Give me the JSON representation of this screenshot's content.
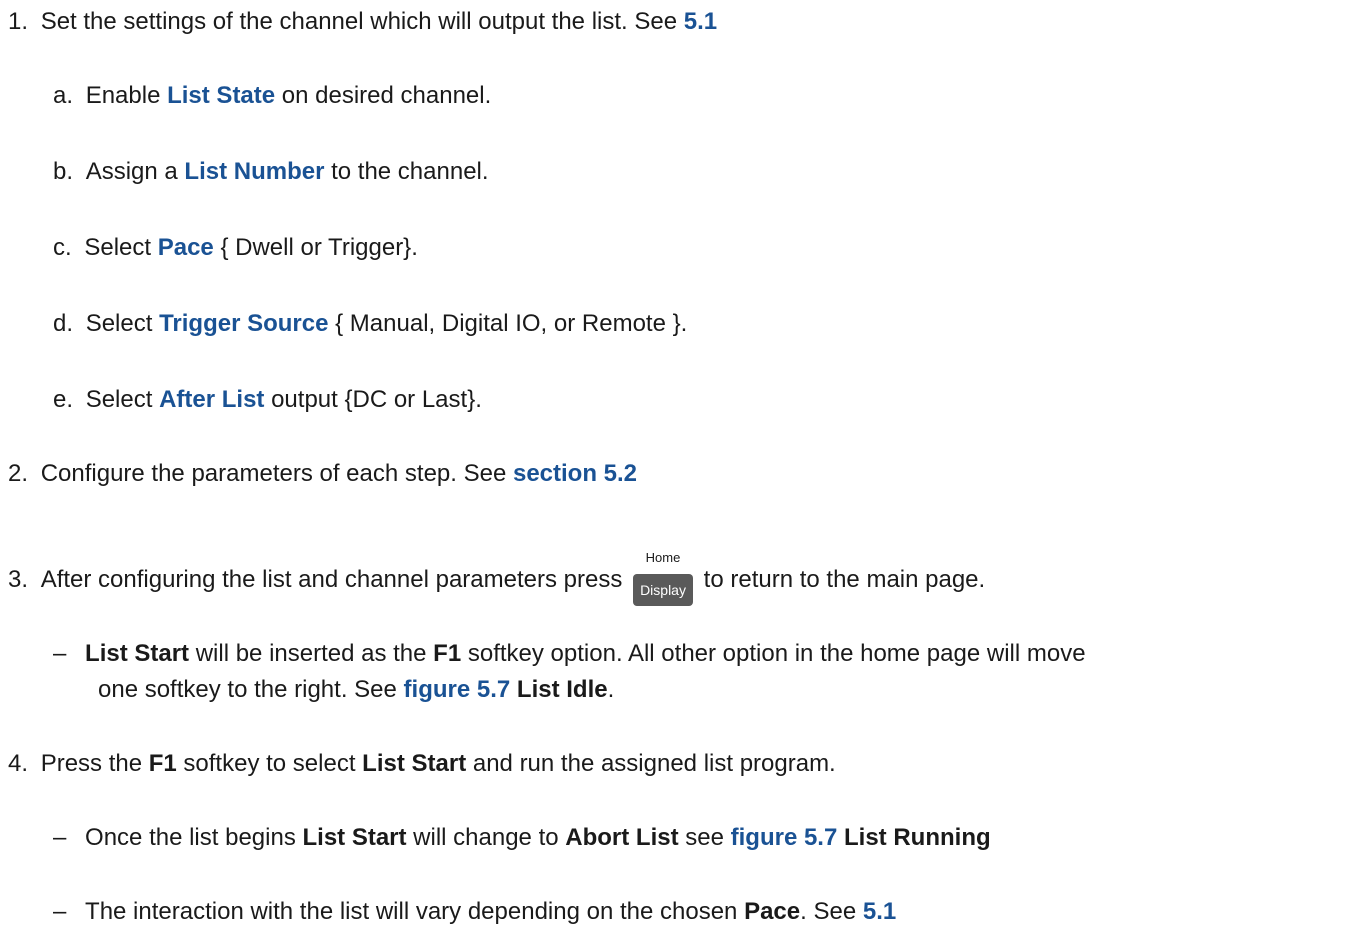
{
  "steps": [
    {
      "number": "1.",
      "pre": "Set the settings of the channel which will output the list. See ",
      "link": "5.1",
      "sub": [
        {
          "letter": "a.",
          "pre": "Enable ",
          "term": "List State",
          "post": " on desired channel."
        },
        {
          "letter": "b.",
          "pre": "Assign a ",
          "term": "List Number",
          "post": " to the channel."
        },
        {
          "letter": "c.",
          "pre": "Select ",
          "term": "Pace",
          "post": " { Dwell or Trigger}."
        },
        {
          "letter": "d.",
          "pre": "Select ",
          "term": "Trigger Source",
          "post": " { Manual, Digital IO, or Remote }."
        },
        {
          "letter": "e.",
          "pre": "Select ",
          "term": "After List",
          "post": " output {DC or Last}."
        }
      ]
    },
    {
      "number": "2.",
      "pre": "Configure the parameters of each step. See ",
      "link": "section 5.2"
    },
    {
      "number": "3.",
      "pre": "After configuring the list and channel parameters press ",
      "key": {
        "top": "Home",
        "label": "Display"
      },
      "post": " to return to the main page.",
      "note": {
        "dash": "–",
        "bold1": "List Start",
        "t1": " will be inserted as the ",
        "bold2": "F1",
        "t2": " softkey option.  All other option in the home page will move",
        "t3": "one softkey to the right. See ",
        "link": "figure 5.7",
        "t4": " ",
        "bold3": "List Idle",
        "t5": "."
      }
    },
    {
      "number": "4.",
      "t1": "Press the ",
      "bold1": "F1",
      "t2": " softkey to select ",
      "bold2": "List Start",
      "t3": " and run the assigned list program.",
      "notes": [
        {
          "dash": "–",
          "t1": "Once the list begins ",
          "bold1": "List Start",
          "t2": " will change to ",
          "bold2": "Abort List",
          "t3": " see ",
          "link": "figure 5.7",
          "t4": " ",
          "bold3": "List Running"
        },
        {
          "dash": "–",
          "t1": "The interaction with the list will vary depending on the chosen ",
          "bold1": "Pace",
          "t2": ".  See ",
          "link": "5.1"
        }
      ]
    }
  ]
}
